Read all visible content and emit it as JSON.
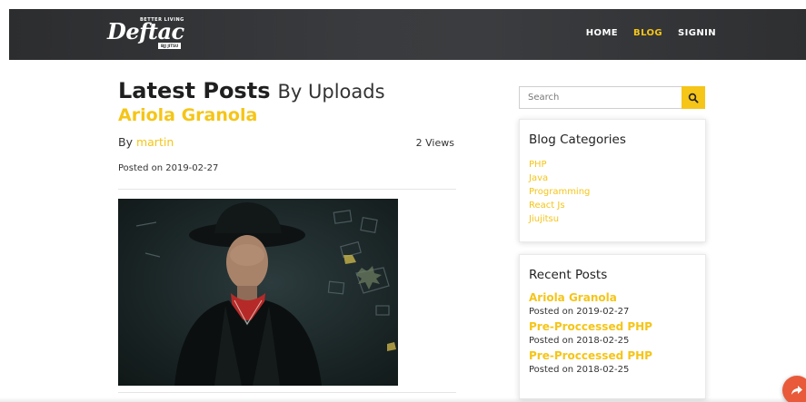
{
  "brand": {
    "logo_text": "Deftac",
    "tagline_top": "BETTER LIVING",
    "tagline_bottom": "BJJ JITSU"
  },
  "nav": {
    "items": [
      {
        "label": "HOME",
        "active": false
      },
      {
        "label": "BLOG",
        "active": true
      },
      {
        "label": "SIGNIN",
        "active": false
      }
    ]
  },
  "main": {
    "heading": "Latest Posts",
    "heading_sub": "By Uploads",
    "post": {
      "title": "Ariola Granola",
      "by_label": "By",
      "author": "martin",
      "views": "2 Views",
      "posted": "Posted on 2019-02-27",
      "image_icon": "portrait-photo"
    }
  },
  "sidebar": {
    "search": {
      "placeholder": "Search",
      "icon": "search-icon"
    },
    "categories": {
      "title": "Blog Categories",
      "items": [
        "PHP",
        "Java",
        "Programming",
        "React Js",
        "Jiujitsu"
      ]
    },
    "recent": {
      "title": "Recent Posts",
      "items": [
        {
          "title": "Ariola Granola",
          "posted": "Posted on 2019-02-27"
        },
        {
          "title": "Pre-Proccessed PHP",
          "posted": "Posted on 2018-02-25"
        },
        {
          "title": "Pre-Proccessed PHP",
          "posted": "Posted on 2018-02-25"
        }
      ]
    }
  },
  "fab": {
    "icon": "share-arrow-icon"
  },
  "colors": {
    "accent": "#f5c518",
    "navbar": "#333538",
    "fab": "#e85a3a",
    "text": "#333333"
  }
}
